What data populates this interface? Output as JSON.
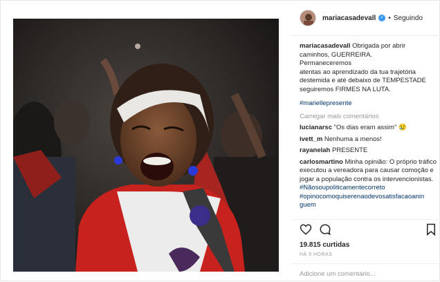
{
  "header": {
    "username": "mariacasadevall",
    "separator": "•",
    "follow_status": "Seguindo"
  },
  "caption": {
    "username": "mariacasadevall",
    "line1": "Obrigada por abrir",
    "line2": "caminhos, GUERREIRA.",
    "line3": "Permaneceremos",
    "line4": "atentas ao aprendizado da tua trajetória",
    "line5": "destemida e até debaixo de TEMPESTADE",
    "line6": "seguiremos FIRMES NA LUTA.",
    "hashtag": "#marielle​presente"
  },
  "load_more": "Carregar mais comentários",
  "comments": [
    {
      "user": "lucianarsc",
      "text": "\"Os dias eram assim\" 😢"
    },
    {
      "user": "ivett_m",
      "text": "Nenhuma a menos!"
    },
    {
      "user": "rayanelah",
      "text": "PRESENTE"
    },
    {
      "user": "carlosmartino",
      "text": "Minha opinião: O próprio tráfico executou a vereadora para causar comoção e jogar a população contra os intervencionistas.",
      "tag1": "#Nãosoupoliticamentecorreto",
      "tag2": "#opinocomoquiserenaodevosatisfacaoanin",
      "tag3": "guem"
    }
  ],
  "likes": "19.815 curtidas",
  "time": "HÁ 9 HORAS",
  "add_comment_placeholder": "Adicione um comentário...",
  "icons": {
    "verified": "verified-badge-icon",
    "like": "heart-icon",
    "comment": "comment-bubble-icon",
    "save": "bookmark-icon"
  },
  "colors": {
    "link_blue": "#003569",
    "verified_blue": "#3897f0",
    "muted": "#999999"
  }
}
